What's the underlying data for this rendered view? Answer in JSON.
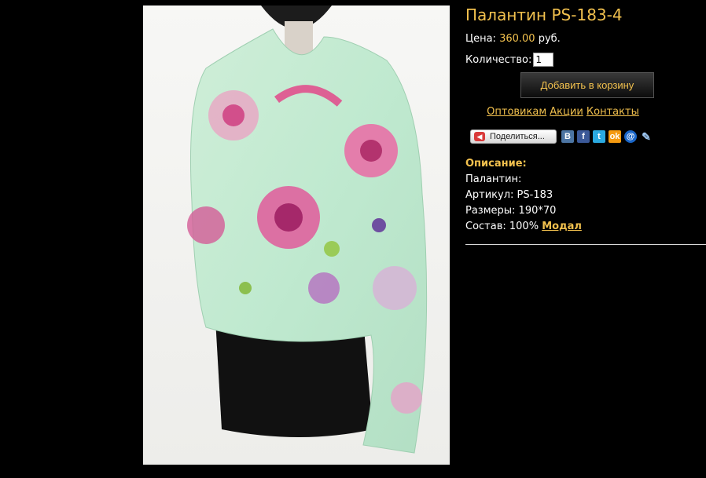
{
  "product": {
    "title": "Палантин PS-183-4",
    "image_alt": "Палантин PS-183-4"
  },
  "price": {
    "label": "Цена:",
    "value": "360.00",
    "currency": "руб."
  },
  "quantity": {
    "label": "Количество:",
    "value": "1"
  },
  "cart": {
    "button_label": "Добавить в корзину"
  },
  "links": [
    {
      "label": "Оптовикам"
    },
    {
      "label": "Акции"
    },
    {
      "label": "Контакты"
    }
  ],
  "share": {
    "button_label": "Поделиться...",
    "services": [
      {
        "icon": "vkontakte-icon",
        "glyph": "В"
      },
      {
        "icon": "facebook-icon",
        "glyph": "f"
      },
      {
        "icon": "twitter-icon",
        "glyph": "t"
      },
      {
        "icon": "odnoklassniki-icon",
        "glyph": "ok"
      },
      {
        "icon": "mail-ru-icon",
        "glyph": "@"
      },
      {
        "icon": "livejournal-icon",
        "glyph": "✎"
      }
    ]
  },
  "description": {
    "heading": "Описание:",
    "type_line": "Палантин:",
    "article_line": "Артикул: PS-183",
    "size_line": "Размеры: 190*70",
    "composition_prefix": "Состав: 100%",
    "composition_link": "Модал"
  },
  "colors": {
    "accent": "#f2c14e",
    "background": "#000000",
    "text": "#ffffff"
  }
}
